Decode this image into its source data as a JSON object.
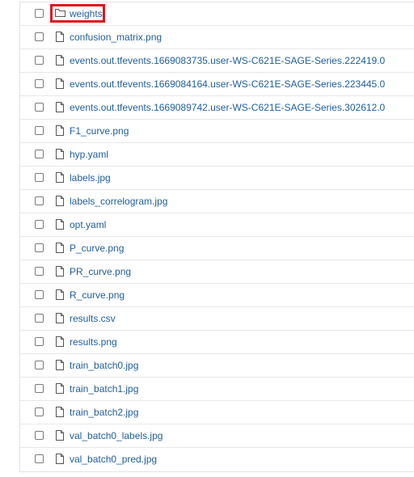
{
  "files": [
    {
      "name": "weights",
      "type": "folder",
      "icon": "folder-icon",
      "highlighted": true
    },
    {
      "name": "confusion_matrix.png",
      "type": "file",
      "icon": "file-icon"
    },
    {
      "name": "events.out.tfevents.1669083735.user-WS-C621E-SAGE-Series.222419.0",
      "type": "file",
      "icon": "file-icon"
    },
    {
      "name": "events.out.tfevents.1669084164.user-WS-C621E-SAGE-Series.223445.0",
      "type": "file",
      "icon": "file-icon"
    },
    {
      "name": "events.out.tfevents.1669089742.user-WS-C621E-SAGE-Series.302612.0",
      "type": "file",
      "icon": "file-icon"
    },
    {
      "name": "F1_curve.png",
      "type": "file",
      "icon": "file-icon"
    },
    {
      "name": "hyp.yaml",
      "type": "file",
      "icon": "file-icon"
    },
    {
      "name": "labels.jpg",
      "type": "file",
      "icon": "file-icon"
    },
    {
      "name": "labels_correlogram.jpg",
      "type": "file",
      "icon": "file-icon"
    },
    {
      "name": "opt.yaml",
      "type": "file",
      "icon": "file-icon"
    },
    {
      "name": "P_curve.png",
      "type": "file",
      "icon": "file-icon"
    },
    {
      "name": "PR_curve.png",
      "type": "file",
      "icon": "file-icon"
    },
    {
      "name": "R_curve.png",
      "type": "file",
      "icon": "file-icon"
    },
    {
      "name": "results.csv",
      "type": "file",
      "icon": "file-icon"
    },
    {
      "name": "results.png",
      "type": "file",
      "icon": "file-icon"
    },
    {
      "name": "train_batch0.jpg",
      "type": "file",
      "icon": "file-icon"
    },
    {
      "name": "train_batch1.jpg",
      "type": "file",
      "icon": "file-icon"
    },
    {
      "name": "train_batch2.jpg",
      "type": "file",
      "icon": "file-icon"
    },
    {
      "name": "val_batch0_labels.jpg",
      "type": "file",
      "icon": "file-icon"
    },
    {
      "name": "val_batch0_pred.jpg",
      "type": "file",
      "icon": "file-icon"
    }
  ],
  "colors": {
    "link": "#1f5e9c",
    "icon": "#555555",
    "highlight_border": "#e0141e"
  }
}
